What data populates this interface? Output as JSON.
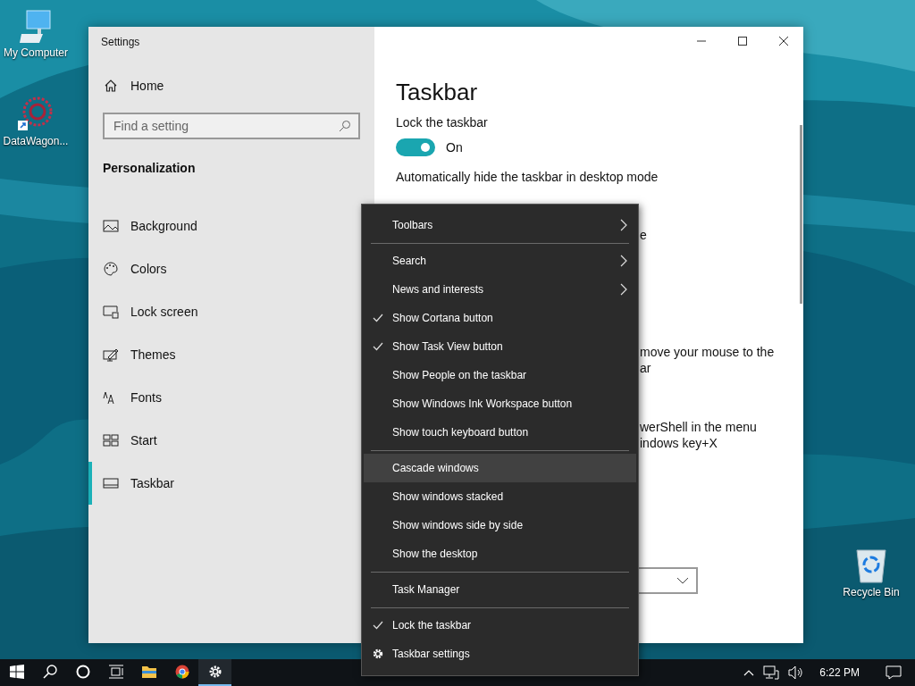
{
  "desktop_icons": [
    {
      "label": "My Computer",
      "kind": "computer"
    },
    {
      "label": "DataWagon...",
      "kind": "shortcut"
    },
    {
      "label": "Recycle Bin",
      "kind": "bin"
    }
  ],
  "settings": {
    "title": "Settings",
    "sidebar": {
      "home": "Home",
      "search": {
        "placeholder": "Find a setting"
      },
      "section": "Personalization",
      "items": [
        {
          "label": "Background",
          "kind": "background",
          "selected": false
        },
        {
          "label": "Colors",
          "kind": "colors",
          "selected": false
        },
        {
          "label": "Lock screen",
          "kind": "lock",
          "selected": false
        },
        {
          "label": "Themes",
          "kind": "themes",
          "selected": false
        },
        {
          "label": "Fonts",
          "kind": "fonts",
          "selected": false
        },
        {
          "label": "Start",
          "kind": "start",
          "selected": false
        },
        {
          "label": "Taskbar",
          "kind": "taskbar",
          "selected": true
        }
      ]
    },
    "content": {
      "title": "Taskbar",
      "blocks": [
        {
          "kind": "label",
          "text": "Lock the taskbar"
        },
        {
          "kind": "toggle",
          "on": true,
          "state_text": "On"
        },
        {
          "kind": "label",
          "text": "Automatically hide the taskbar in desktop mode"
        },
        {
          "kind": "fragment",
          "lines": [
            "e"
          ]
        },
        {
          "kind": "fragment",
          "lines": [
            "move your mouse to the",
            "ar"
          ]
        },
        {
          "kind": "fragment",
          "lines": [
            "werShell in the menu",
            "indows key+X"
          ]
        },
        {
          "kind": "dropdown"
        }
      ]
    }
  },
  "context_menu": {
    "groups": [
      [
        {
          "label": "Toolbars",
          "kind": "submenu",
          "checked": false,
          "selected": false
        }
      ],
      [
        {
          "label": "Search",
          "kind": "submenu",
          "checked": false,
          "selected": false
        },
        {
          "label": "News and interests",
          "kind": "submenu",
          "checked": false,
          "selected": false
        },
        {
          "label": "Show Cortana button",
          "kind": "command",
          "checked": true,
          "selected": false
        },
        {
          "label": "Show Task View button",
          "kind": "command",
          "checked": true,
          "selected": false
        },
        {
          "label": "Show People on the taskbar",
          "kind": "command",
          "checked": false,
          "selected": false
        },
        {
          "label": "Show Windows Ink Workspace button",
          "kind": "command",
          "checked": false,
          "selected": false
        },
        {
          "label": "Show touch keyboard button",
          "kind": "command",
          "checked": false,
          "selected": false
        }
      ],
      [
        {
          "label": "Cascade windows",
          "kind": "command",
          "checked": false,
          "selected": true
        },
        {
          "label": "Show windows stacked",
          "kind": "command",
          "checked": false,
          "selected": false
        },
        {
          "label": "Show windows side by side",
          "kind": "command",
          "checked": false,
          "selected": false
        },
        {
          "label": "Show the desktop",
          "kind": "command",
          "checked": false,
          "selected": false
        }
      ],
      [
        {
          "label": "Task Manager",
          "kind": "command",
          "checked": false,
          "selected": false
        }
      ],
      [
        {
          "label": "Lock the taskbar",
          "kind": "command",
          "checked": true,
          "selected": false
        },
        {
          "label": "Taskbar settings",
          "kind": "settings",
          "checked": false,
          "selected": false
        }
      ]
    ]
  },
  "taskbar": {
    "apps": [
      {
        "kind": "start",
        "running": false
      },
      {
        "kind": "search",
        "running": false
      },
      {
        "kind": "cortana",
        "running": false
      },
      {
        "kind": "taskview",
        "running": false
      },
      {
        "kind": "explorer",
        "running": false
      },
      {
        "kind": "chrome",
        "running": false
      },
      {
        "kind": "settings",
        "running": true
      }
    ],
    "clock": "6:22 PM"
  }
}
